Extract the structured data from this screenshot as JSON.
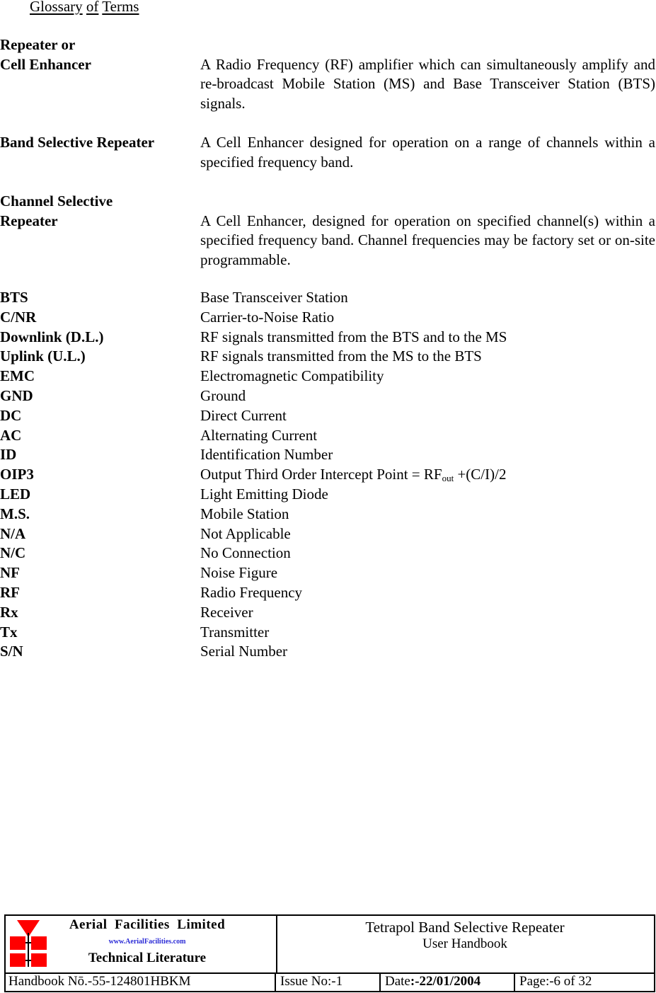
{
  "page": {
    "title_words": [
      "Glossary",
      "of",
      "Terms"
    ]
  },
  "definitions": [
    {
      "term_lines": [
        "Repeater or",
        "Cell Enhancer"
      ],
      "definition": "A Radio Frequency (RF) amplifier which can simultaneously amplify and re-broadcast Mobile Station (MS) and Base Transceiver Station (BTS) signals."
    },
    {
      "term_lines": [
        "Band Selective Repeater"
      ],
      "definition": "A Cell Enhancer designed for operation on a range of channels within a specified frequency band."
    },
    {
      "term_lines": [
        "Channel Selective",
        "Repeater"
      ],
      "definition": "A Cell Enhancer, designed for operation on specified channel(s) within a specified frequency band. Channel frequencies may be factory set or on-site programmable."
    }
  ],
  "abbreviations": [
    {
      "abbr": "BTS",
      "meaning": "Base Transceiver Station"
    },
    {
      "abbr": "C/NR",
      "meaning": "Carrier-to-Noise Ratio"
    },
    {
      "abbr": "Downlink (D.L.)",
      "meaning": "RF signals transmitted from the BTS and to the MS"
    },
    {
      "abbr": "Uplink (U.L.)",
      "meaning": "RF signals transmitted from the MS to the BTS"
    },
    {
      "abbr": "EMC",
      "meaning": "Electromagnetic Compatibility"
    },
    {
      "abbr": "GND",
      "meaning": "Ground"
    },
    {
      "abbr": "DC",
      "meaning": "Direct Current"
    },
    {
      "abbr": "AC",
      "meaning": "Alternating Current"
    },
    {
      "abbr": "ID",
      "meaning": "Identification Number"
    },
    {
      "abbr": "OIP3",
      "meaning_prefix": "Output Third Order Intercept Point = RF",
      "meaning_sub": "out",
      "meaning_suffix": " +(C/I)/2"
    },
    {
      "abbr": "LED",
      "meaning": "Light Emitting Diode"
    },
    {
      "abbr": "M.S.",
      "meaning": "Mobile Station"
    },
    {
      "abbr": "N/A",
      "meaning": "Not Applicable"
    },
    {
      "abbr": "N/C",
      "meaning": "No Connection"
    },
    {
      "abbr": "NF",
      "meaning": "Noise Figure"
    },
    {
      "abbr": "RF",
      "meaning": "Radio Frequency"
    },
    {
      "abbr": "Rx",
      "meaning": "Receiver"
    },
    {
      "abbr": "Tx",
      "meaning": "Transmitter"
    },
    {
      "abbr": "S/N",
      "meaning": "Serial Number"
    }
  ],
  "footer": {
    "logo": {
      "company": "Aerial  Facilities  Limited",
      "url": "www.AerialFacilities.com",
      "subtitle": "Technical Literature",
      "icon": "aerial-facilities-logo-icon",
      "color": "#ff0000"
    },
    "doc_title": "Tetrapol Band Selective Repeater",
    "doc_subtitle": "User Handbook",
    "handbook_no": "Handbook Nō.-55-124801HBKM",
    "issue": "Issue No:-1",
    "date_label": "Date",
    "date_value": ":-22/01/2004",
    "page_label": "Page",
    "page_value": ":-6 of 32"
  }
}
